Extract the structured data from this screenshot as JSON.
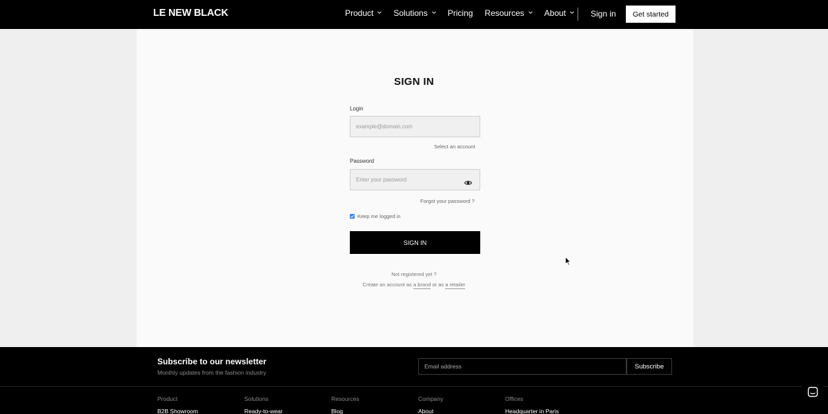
{
  "header": {
    "logo": "LE NEW BLACK",
    "nav": [
      {
        "label": "Product",
        "has_dropdown": true
      },
      {
        "label": "Solutions",
        "has_dropdown": true
      },
      {
        "label": "Pricing",
        "has_dropdown": false
      },
      {
        "label": "Resources",
        "has_dropdown": true
      },
      {
        "label": "About",
        "has_dropdown": true
      }
    ],
    "sign_in": "Sign in",
    "get_started": "Get started"
  },
  "form": {
    "title": "SIGN IN",
    "login_label": "Login",
    "login_placeholder": "example@domain.com",
    "select_account": "Select an account",
    "password_label": "Password",
    "password_placeholder": "Enter your password",
    "forgot_password": "Forgot your password ?",
    "keep_logged_in": "Keep me logged in",
    "keep_logged_in_checked": true,
    "submit": "SIGN IN",
    "not_registered": "Not registered yet ?",
    "create_prefix": "Create an account as",
    "brand_link": "a brand",
    "or_as": "or as",
    "retailer_link": "a retailer"
  },
  "footer": {
    "newsletter_title": "Subscribe to our newsletter",
    "newsletter_subtitle": "Monthly updates from the fashion industry",
    "email_placeholder": "Email address",
    "subscribe": "Subscribe",
    "columns": [
      {
        "heading": "Product",
        "first_link": "B2B Showroom"
      },
      {
        "heading": "Solutions",
        "first_link": "Ready-to-wear"
      },
      {
        "heading": "Resources",
        "first_link": "Blog"
      },
      {
        "heading": "Company",
        "first_link": "About"
      },
      {
        "heading": "Offices",
        "first_link": "Headquarter in Paris"
      }
    ]
  },
  "colors": {
    "accent": "#3b82f6",
    "background": "#efefef",
    "panel": "#fafafa",
    "dark": "#000000"
  }
}
